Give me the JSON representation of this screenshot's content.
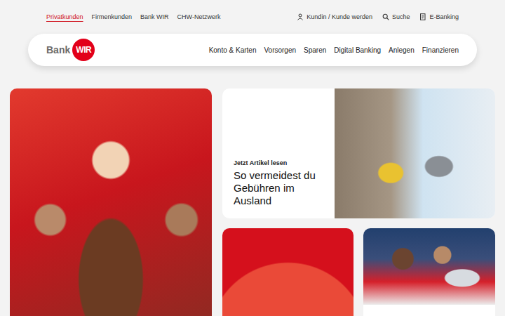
{
  "topnav": {
    "items": [
      {
        "label": "Privatkunden",
        "selected": true
      },
      {
        "label": "Firmenkunden",
        "selected": false
      },
      {
        "label": "Bank WIR",
        "selected": false
      },
      {
        "label": "CHW-Netzwerk",
        "selected": false
      }
    ],
    "actions": [
      {
        "label": "Kundin / Kunde werden",
        "kind": "person"
      },
      {
        "label": "Suche",
        "kind": "search"
      },
      {
        "label": "E-Banking",
        "kind": "ebanking"
      }
    ]
  },
  "logo": {
    "bank": "Bank",
    "wir": "WIR"
  },
  "mainnav": [
    "Konto & Karten",
    "Vorsorgen",
    "Sparen",
    "Digital Banking",
    "Anlegen",
    "Finanzieren"
  ],
  "teaser": {
    "kicker": "Jetzt Artikel lesen",
    "title": "So vermeidest du Gebühren im Ausland"
  }
}
